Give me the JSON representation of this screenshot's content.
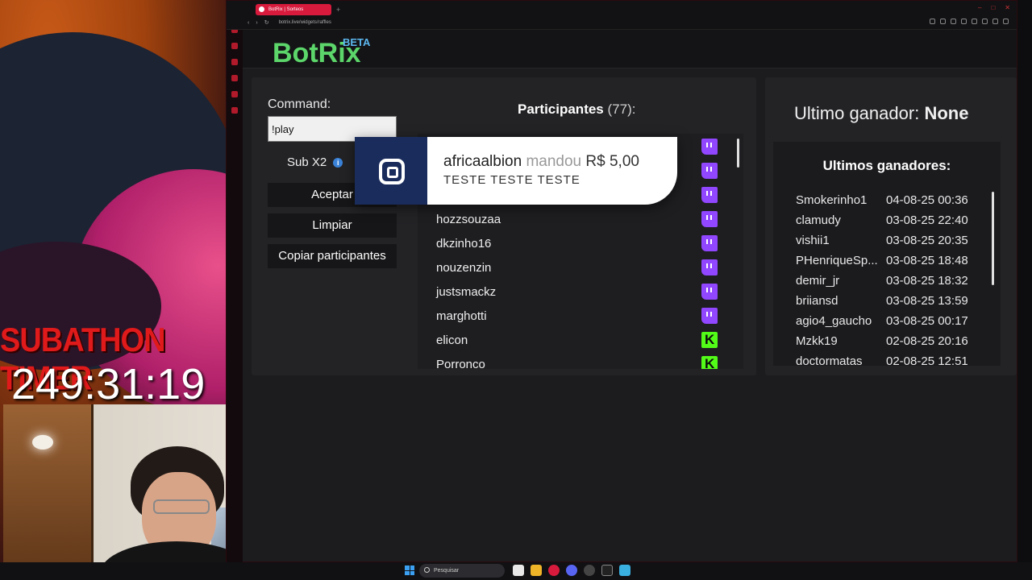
{
  "overlay": {
    "subathon_title": "SUBATHON TIMER",
    "subathon_time": "249:31:19"
  },
  "browser": {
    "tab_title": "BotRix | Sorteos",
    "url": "botrix.live/widgets/raffles"
  },
  "header": {
    "logo": "BotRix",
    "logo_badge": "BETA"
  },
  "raffle": {
    "command_label": "Command:",
    "command_value": "!play",
    "sub_label": "Sub X2",
    "accept_button": "Aceptar",
    "clear_button": "Limpiar",
    "copy_button": "Copiar participantes",
    "participants_label": "Participantes",
    "participants_count": "(77):",
    "participants": [
      {
        "name": "",
        "platform": "twitch"
      },
      {
        "name": "",
        "platform": "twitch"
      },
      {
        "name": "",
        "platform": "twitch"
      },
      {
        "name": "hozzsouzaa",
        "platform": "twitch"
      },
      {
        "name": "dkzinho16",
        "platform": "twitch"
      },
      {
        "name": "nouzenzin",
        "platform": "twitch"
      },
      {
        "name": "justsmackz",
        "platform": "twitch"
      },
      {
        "name": "marghotti",
        "platform": "twitch"
      },
      {
        "name": "elicon",
        "platform": "kick"
      },
      {
        "name": "Porronco",
        "platform": "kick"
      }
    ]
  },
  "alert": {
    "username": "africaalbion",
    "verb": "mandou",
    "amount": "R$ 5,00",
    "message": "TESTE TESTE TESTE"
  },
  "winners": {
    "last_winner_label": "Ultimo ganador:",
    "last_winner_value": "None",
    "list_title": "Ultimos ganadores:",
    "list": [
      {
        "name": "Smokerinho1",
        "date": "04-08-25 00:36"
      },
      {
        "name": "clamudy",
        "date": "03-08-25 22:40"
      },
      {
        "name": "vishii1",
        "date": "03-08-25 20:35"
      },
      {
        "name": "PHenriqueSp...",
        "date": "03-08-25 18:48"
      },
      {
        "name": "demir_jr",
        "date": "03-08-25 18:32"
      },
      {
        "name": "briiansd",
        "date": "03-08-25 13:59"
      },
      {
        "name": "agio4_gaucho",
        "date": "03-08-25 00:17"
      },
      {
        "name": "Mzkk19",
        "date": "02-08-25 20:16"
      },
      {
        "name": "doctormatas",
        "date": "02-08-25 12:51"
      }
    ]
  },
  "taskbar": {
    "search_placeholder": "Pesquisar"
  },
  "colors": {
    "botrix_green": "#5cd66a",
    "twitch_purple": "#9146ff",
    "kick_green": "#53fc18",
    "opera_red": "#d81a3c"
  }
}
